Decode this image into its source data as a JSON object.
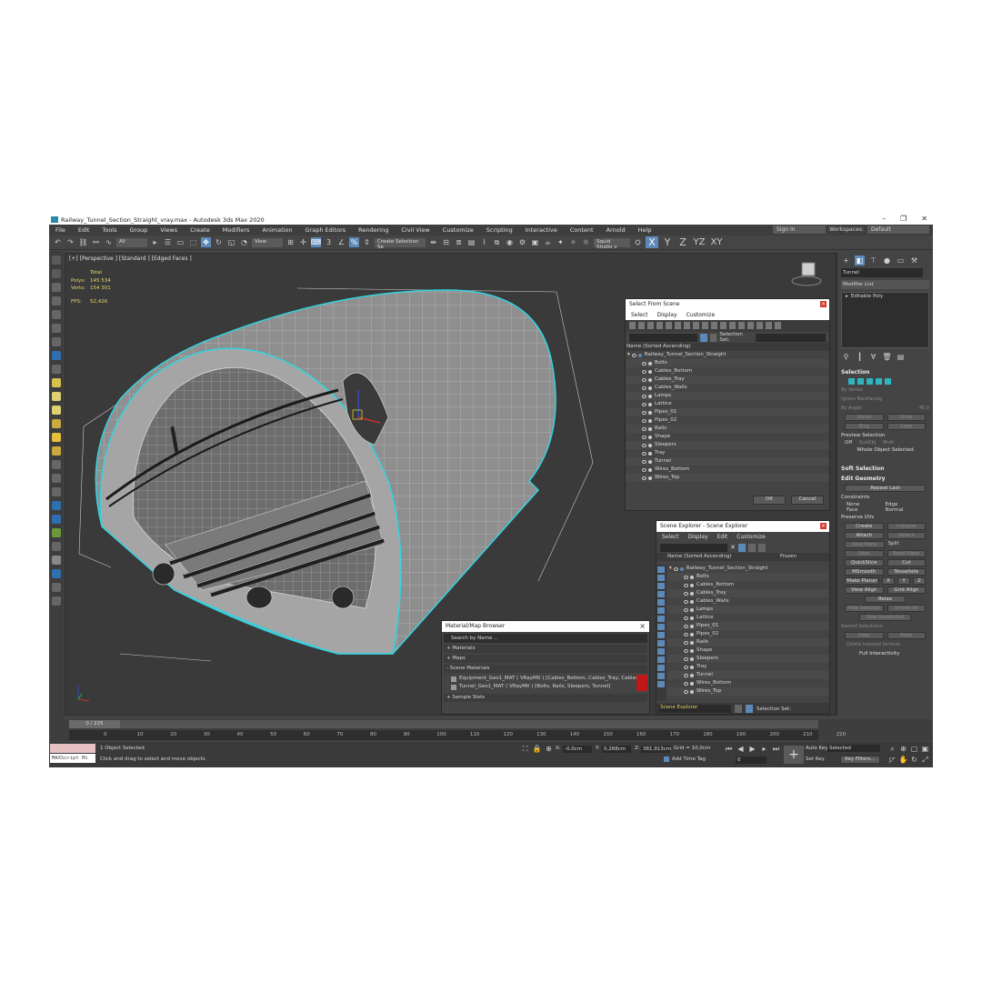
{
  "window": {
    "title": "Railway_Tunnel_Section_Straight_vray.max - Autodesk 3ds Max 2020",
    "minimize": "–",
    "maximize": "❐",
    "close": "✕"
  },
  "menu": {
    "items": [
      "File",
      "Edit",
      "Tools",
      "Group",
      "Views",
      "Create",
      "Modifiers",
      "Animation",
      "Graph Editors",
      "Rendering",
      "Civil View",
      "Customize",
      "Scripting",
      "Interactive",
      "Content",
      "Arnold",
      "Help"
    ],
    "sign_in": "Sign In",
    "workspaces_label": "Workspaces:",
    "workspaces_value": "Default"
  },
  "toolbar": {
    "filter": "All",
    "ref_coord": "View",
    "selection_set": "Create Selection Se",
    "squid": "Squid Studio v",
    "axes": [
      "X",
      "Y",
      "Z",
      "YZ",
      "XY"
    ]
  },
  "viewport": {
    "label": "[+] [Perspective ] [Standard ] [Edged Faces ]",
    "stats_total": "Total",
    "polys_label": "Polys:",
    "polys_value": "145 534",
    "verts_label": "Verts:",
    "verts_value": "154 301",
    "fps_label": "FPS:",
    "fps_value": "52,426"
  },
  "select_from_scene": {
    "title": "Select From Scene",
    "menu": [
      "Select",
      "Display",
      "Customize"
    ],
    "selection_set": "Selection Set:",
    "column": "Name (Sorted Ascending)",
    "root": "Railway_Tunnel_Section_Straight",
    "items": [
      "Bolts",
      "Cables_Bottom",
      "Cables_Tray",
      "Cables_Walls",
      "Lamps",
      "Lattice",
      "Pipes_01",
      "Pipes_02",
      "Rails",
      "Shape",
      "Sleepers",
      "Tray",
      "Tunnel",
      "Wires_Bottom",
      "Wires_Top"
    ],
    "ok": "OK",
    "cancel": "Cancel"
  },
  "scene_explorer": {
    "title": "Scene Explorer - Scene Explorer",
    "menu": [
      "Select",
      "Display",
      "Edit",
      "Customize"
    ],
    "column": "Name (Sorted Ascending)",
    "frozen": "Frozen",
    "root": "Railway_Tunnel_Section_Straight",
    "items": [
      "Bolts",
      "Cables_Bottom",
      "Cables_Tray",
      "Cables_Walls",
      "Lamps",
      "Lattice",
      "Pipes_01",
      "Pipes_02",
      "Rails",
      "Shape",
      "Sleepers",
      "Tray",
      "Tunnel",
      "Wires_Bottom",
      "Wires_Top"
    ],
    "footer_name": "Scene Explorer",
    "selection_set": "Selection Set:"
  },
  "material_browser": {
    "title": "Material/Map Browser",
    "search": "Search by Name ...",
    "sections": [
      "+ Materials",
      "+ Maps",
      "- Scene Materials"
    ],
    "materials": [
      "Equipment_Geo1_MAT ( VRayMtl ) [Cables_Bottom, Cables_Tray, Cables_",
      "Tunnel_Geo1_MAT ( VRayMtl ) [Bolts, Rails, Sleepers, Tunnel]"
    ],
    "sample_slots": "+ Sample Slots"
  },
  "command_panel": {
    "object_name": "Tunnel",
    "modifier_list": "Modifier List",
    "stack_item": "Editable Poly",
    "selection_head": "Selection",
    "by_vertex": "By Vertex",
    "ignore_backfacing": "Ignore Backfacing",
    "by_angle": "By Angle:",
    "by_angle_value": "45,0",
    "shrink": "Shrink",
    "grow": "Grow",
    "ring": "Ring",
    "loop": "Loop",
    "preview_selection": "Preview Selection",
    "off": "Off",
    "subobj": "SubObj",
    "multi": "Multi",
    "whole_object": "Whole Object Selected",
    "soft_selection": "Soft Selection",
    "edit_geometry": "Edit Geometry",
    "repeat_last": "Repeat Last",
    "constraints": "Constraints",
    "c_none": "None",
    "c_edge": "Edge",
    "c_face": "Face",
    "c_normal": "Normal",
    "preserve_uvs": "Preserve UVs",
    "create": "Create",
    "collapse": "Collapse",
    "attach": "Attach",
    "detach": "Detach",
    "slice_plane": "Slice Plane",
    "split": "Split",
    "slice": "Slice",
    "reset_plane": "Reset Plane",
    "quickslice": "QuickSlice",
    "cut": "Cut",
    "msmooth": "MSmooth",
    "tessellate": "Tessellate",
    "make_planar": "Make Planar",
    "x": "X",
    "y": "Y",
    "z": "Z",
    "view_align": "View Align",
    "grid_align": "Grid Align",
    "relax": "Relax",
    "hide_selected": "Hide Selected",
    "unhide_all": "Unhide All",
    "hide_unselected": "Hide Unselected",
    "named_selections": "Named Selections:",
    "copy": "Copy",
    "paste": "Paste",
    "delete_isolated": "Delete Isolated Vertices",
    "full_interactivity": "Full Interactivity"
  },
  "timeline": {
    "frame": "0 / 225",
    "ticks": [
      "0",
      "10",
      "20",
      "30",
      "40",
      "50",
      "60",
      "70",
      "80",
      "90",
      "100",
      "110",
      "120",
      "130",
      "140",
      "150",
      "160",
      "170",
      "180",
      "190",
      "200",
      "210",
      "220"
    ]
  },
  "status": {
    "maxscript": "MAXScript Mi",
    "objects_selected": "1 Object Selected",
    "hint": "Click and drag to select and move objects",
    "x_label": "X:",
    "x_value": "-0,0cm",
    "y_label": "Y:",
    "y_value": "0,268cm",
    "z_label": "Z:",
    "z_value": "381,913cm",
    "grid": "Grid = 10,0cm",
    "add_time_tag": "Add Time Tag",
    "auto_key": "Auto Key",
    "selected": "Selected",
    "set_key": "Set Key",
    "key_filters": "Key Filters...",
    "frame_field": "0"
  },
  "colors": {
    "accent": "#5d89b8",
    "selection_outline": "#34d3e0",
    "stats": "#e8d66a",
    "danger": "#d9372b"
  }
}
